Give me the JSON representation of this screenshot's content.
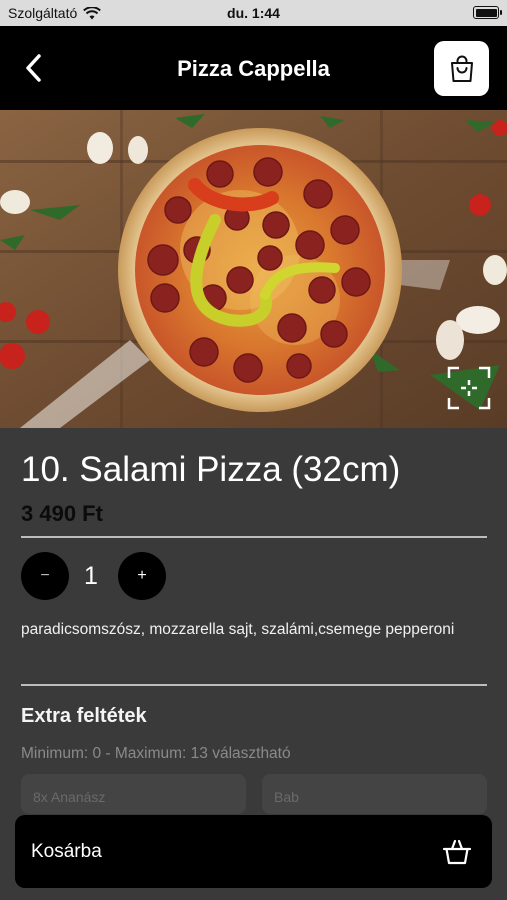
{
  "status_bar": {
    "carrier": "Szolgáltató",
    "time": "du. 1:44"
  },
  "nav": {
    "title": "Pizza Cappella"
  },
  "product": {
    "title": "10. Salami Pizza (32cm)",
    "price": "3 490 Ft",
    "quantity": "1",
    "minus_symbol": "−",
    "plus_symbol": "+",
    "description": "paradicsomszósz, mozzarella sajt, szalámi,csemege pepperoni"
  },
  "extras": {
    "title": "Extra feltétek",
    "subtitle": "Minimum: 0 - Maximum: 13 választható",
    "options": [
      "8x Ananász",
      "Bab"
    ]
  },
  "footer": {
    "add_to_cart_label": "Kosárba"
  },
  "colors": {
    "background": "#3a3a3a",
    "nav_background": "#000000",
    "button_background": "#000000",
    "cart_button_background": "#ffffff"
  },
  "icons": {
    "wifi": "wifi-icon",
    "battery": "battery-icon",
    "back": "chevron-left-icon",
    "cart": "shopping-bag-icon",
    "fullscreen": "fullscreen-icon",
    "basket": "basket-icon"
  }
}
